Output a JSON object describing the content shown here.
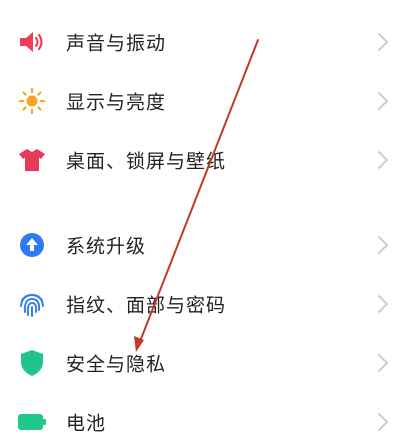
{
  "settings": {
    "items": [
      {
        "label": "声音与振动",
        "icon": "speaker-icon",
        "color": "#ee3f58"
      },
      {
        "label": "显示与亮度",
        "icon": "sun-icon",
        "color": "#f5a623"
      },
      {
        "label": "桌面、锁屏与壁纸",
        "icon": "tshirt-icon",
        "color": "#e8395a"
      },
      {
        "label": "系统升级",
        "icon": "upgrade-arrow-icon",
        "color": "#2d7bf4"
      },
      {
        "label": "指纹、面部与密码",
        "icon": "fingerprint-icon",
        "color": "#3a7df0"
      },
      {
        "label": "安全与隐私",
        "icon": "shield-icon",
        "color": "#21c48f"
      },
      {
        "label": "电池",
        "icon": "battery-icon",
        "color": "#1fc98a"
      }
    ]
  },
  "colors": {
    "chevron": "#c8c8c8",
    "annotation_arrow": "#c0392b"
  }
}
